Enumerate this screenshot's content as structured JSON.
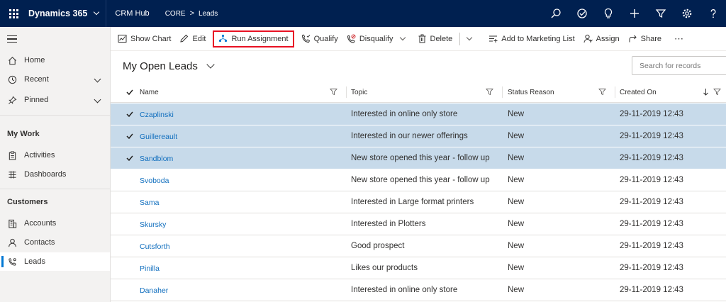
{
  "topbar": {
    "app_title": "Dynamics 365",
    "hub": "CRM Hub",
    "crumb_area": "CORE",
    "crumb_sep": ">",
    "crumb_page": "Leads"
  },
  "sidebar": {
    "items": [
      {
        "label": "Home"
      },
      {
        "label": "Recent"
      },
      {
        "label": "Pinned"
      }
    ],
    "sections": [
      {
        "title": "My Work",
        "items": [
          {
            "label": "Activities"
          },
          {
            "label": "Dashboards"
          }
        ]
      },
      {
        "title": "Customers",
        "items": [
          {
            "label": "Accounts"
          },
          {
            "label": "Contacts"
          },
          {
            "label": "Leads"
          }
        ]
      }
    ]
  },
  "commands": {
    "show_chart": "Show Chart",
    "edit": "Edit",
    "run_assignment": "Run Assignment",
    "qualify": "Qualify",
    "disqualify": "Disqualify",
    "delete": "Delete",
    "add_marketing": "Add to Marketing List",
    "assign": "Assign",
    "share": "Share",
    "more": "⋯"
  },
  "view": {
    "title": "My Open Leads",
    "search_placeholder": "Search for records"
  },
  "grid": {
    "columns": [
      "Name",
      "Topic",
      "Status Reason",
      "Created On"
    ],
    "rows": [
      {
        "name": "Czaplinski",
        "topic": "Interested in online only store",
        "status": "New",
        "created": "29-11-2019 12:43",
        "selected": true
      },
      {
        "name": "Guillereault",
        "topic": "Interested in our newer offerings",
        "status": "New",
        "created": "29-11-2019 12:43",
        "selected": true
      },
      {
        "name": "Sandblom",
        "topic": "New store opened this year - follow up",
        "status": "New",
        "created": "29-11-2019 12:43",
        "selected": true
      },
      {
        "name": "Svoboda",
        "topic": "New store opened this year - follow up",
        "status": "New",
        "created": "29-11-2019 12:43",
        "selected": false
      },
      {
        "name": "Sama",
        "topic": "Interested in Large format printers",
        "status": "New",
        "created": "29-11-2019 12:43",
        "selected": false
      },
      {
        "name": "Skursky",
        "topic": "Interested in Plotters",
        "status": "New",
        "created": "29-11-2019 12:43",
        "selected": false
      },
      {
        "name": "Cutsforth",
        "topic": "Good prospect",
        "status": "New",
        "created": "29-11-2019 12:43",
        "selected": false
      },
      {
        "name": "Pinilla",
        "topic": "Likes our products",
        "status": "New",
        "created": "29-11-2019 12:43",
        "selected": false
      },
      {
        "name": "Danaher",
        "topic": "Interested in online only store",
        "status": "New",
        "created": "29-11-2019 12:43",
        "selected": false
      }
    ]
  },
  "colors": {
    "topbar_bg": "#002050",
    "link": "#106ebe",
    "selected_row": "#c7daea",
    "highlight_border": "#e81123",
    "active_nav": "#0078d4"
  }
}
